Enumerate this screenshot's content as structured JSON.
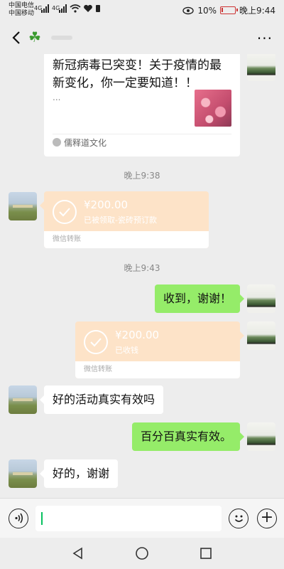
{
  "status_bar": {
    "carrier_1": "中国电信",
    "carrier_2": "中国移动",
    "net_1": "4G",
    "net_2": "4G",
    "battery": "10%",
    "time": "晚上9:44"
  },
  "header": {
    "contact_icon": "four-leaf-clover",
    "back_icon": "chevron-left-icon",
    "more_label": "···"
  },
  "messages": {
    "article": {
      "title": "新冠病毒已突变！关于疫情的最新变化，你一定要知道！！",
      "ellipsis": "...",
      "source": "儒释道文化"
    },
    "time_1": "晚上9:38",
    "transfer_1": {
      "amount": "¥200.00",
      "status": "已被领取-瓷砖预订款",
      "label": "微信转账"
    },
    "time_2": "晚上9:43",
    "reply_1": "收到，谢谢！",
    "transfer_2": {
      "amount": "¥200.00",
      "status": "已收钱",
      "label": "微信转账"
    },
    "msg_1": "好的活动真实有效吗",
    "reply_2": "百分百真实有效。",
    "msg_2": "好的，谢谢"
  },
  "input_bar": {
    "voice_icon": "voice-icon",
    "emoji_icon": "emoji-icon",
    "plus_label": "+"
  },
  "colors": {
    "sent_bubble": "#95ec69",
    "transfer_card": "#fde3c8",
    "background": "#ededed"
  },
  "battery_level": 0.1
}
